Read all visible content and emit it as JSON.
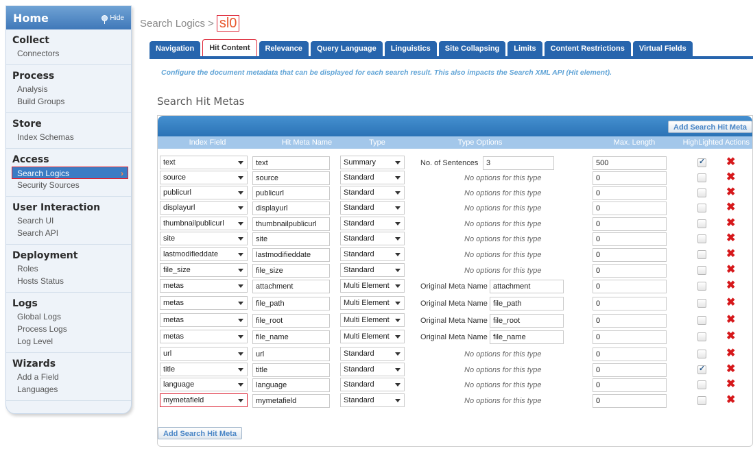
{
  "sidebar": {
    "home": "Home",
    "hide": "Hide",
    "sections": [
      {
        "title": "Collect",
        "items": [
          "Connectors"
        ]
      },
      {
        "title": "Process",
        "items": [
          "Analysis",
          "Build Groups"
        ]
      },
      {
        "title": "Store",
        "items": [
          "Index Schemas"
        ]
      },
      {
        "title": "Access",
        "items": [
          "Search Logics",
          "Security Sources"
        ]
      },
      {
        "title": "User Interaction",
        "items": [
          "Search UI",
          "Search API"
        ]
      },
      {
        "title": "Deployment",
        "items": [
          "Roles",
          "Hosts Status"
        ]
      },
      {
        "title": "Logs",
        "items": [
          "Global Logs",
          "Process Logs",
          "Log Level"
        ]
      },
      {
        "title": "Wizards",
        "items": [
          "Add a Field",
          "Languages"
        ]
      }
    ],
    "active_item": "Search Logics"
  },
  "breadcrumb": {
    "parent": "Search Logics",
    "separator": ">",
    "current": "sl0"
  },
  "tabs": [
    "Navigation",
    "Hit Content",
    "Relevance",
    "Query Language",
    "Linguistics",
    "Site Collapsing",
    "Limits",
    "Content Restrictions",
    "Virtual Fields"
  ],
  "active_tab": "Hit Content",
  "description": "Configure the document metadata that can be displayed for each search result. This also impacts the Search XML API (Hit element).",
  "section_title": "Search Hit Metas",
  "add_button": "Add Search Hit Meta",
  "columns": [
    "Index Field",
    "Hit Meta Name",
    "Type",
    "Type Options",
    "Max. Length",
    "HighLighted",
    "Actions"
  ],
  "no_options_text": "No options for this type",
  "rows": [
    {
      "index_field": "text",
      "meta_name": "text",
      "type": "Summary",
      "option_label": "No. of Sentences",
      "option_value": "3",
      "max_length": "500",
      "highlighted": true
    },
    {
      "index_field": "source",
      "meta_name": "source",
      "type": "Standard",
      "max_length": "0",
      "highlighted": false
    },
    {
      "index_field": "publicurl",
      "meta_name": "publicurl",
      "type": "Standard",
      "max_length": "0",
      "highlighted": false
    },
    {
      "index_field": "displayurl",
      "meta_name": "displayurl",
      "type": "Standard",
      "max_length": "0",
      "highlighted": false
    },
    {
      "index_field": "thumbnailpublicurl",
      "meta_name": "thumbnailpublicurl",
      "type": "Standard",
      "max_length": "0",
      "highlighted": false
    },
    {
      "index_field": "site",
      "meta_name": "site",
      "type": "Standard",
      "max_length": "0",
      "highlighted": false
    },
    {
      "index_field": "lastmodifieddate",
      "meta_name": "lastmodifieddate",
      "type": "Standard",
      "max_length": "0",
      "highlighted": false
    },
    {
      "index_field": "file_size",
      "meta_name": "file_size",
      "type": "Standard",
      "max_length": "0",
      "highlighted": false
    },
    {
      "index_field": "metas",
      "meta_name": "attachment",
      "type": "Multi Element",
      "option_label": "Original Meta Name",
      "option_value": "attachment",
      "max_length": "0",
      "highlighted": false
    },
    {
      "index_field": "metas",
      "meta_name": "file_path",
      "type": "Multi Element",
      "option_label": "Original Meta Name",
      "option_value": "file_path",
      "max_length": "0",
      "highlighted": false
    },
    {
      "index_field": "metas",
      "meta_name": "file_root",
      "type": "Multi Element",
      "option_label": "Original Meta Name",
      "option_value": "file_root",
      "max_length": "0",
      "highlighted": false
    },
    {
      "index_field": "metas",
      "meta_name": "file_name",
      "type": "Multi Element",
      "option_label": "Original Meta Name",
      "option_value": "file_name",
      "max_length": "0",
      "highlighted": false
    },
    {
      "index_field": "url",
      "meta_name": "url",
      "type": "Standard",
      "max_length": "0",
      "highlighted": false
    },
    {
      "index_field": "title",
      "meta_name": "title",
      "type": "Standard",
      "max_length": "0",
      "highlighted": true
    },
    {
      "index_field": "language",
      "meta_name": "language",
      "type": "Standard",
      "max_length": "0",
      "highlighted": false
    },
    {
      "index_field": "mymetafield",
      "meta_name": "mymetafield",
      "type": "Standard",
      "max_length": "0",
      "highlighted": false
    }
  ],
  "colors": {
    "accent": "#2765ad",
    "header_bar": "#3a82c4",
    "active_sidebar": "#3b7cc4",
    "delete": "#d6181b",
    "highlight_border": "#dd2233"
  }
}
